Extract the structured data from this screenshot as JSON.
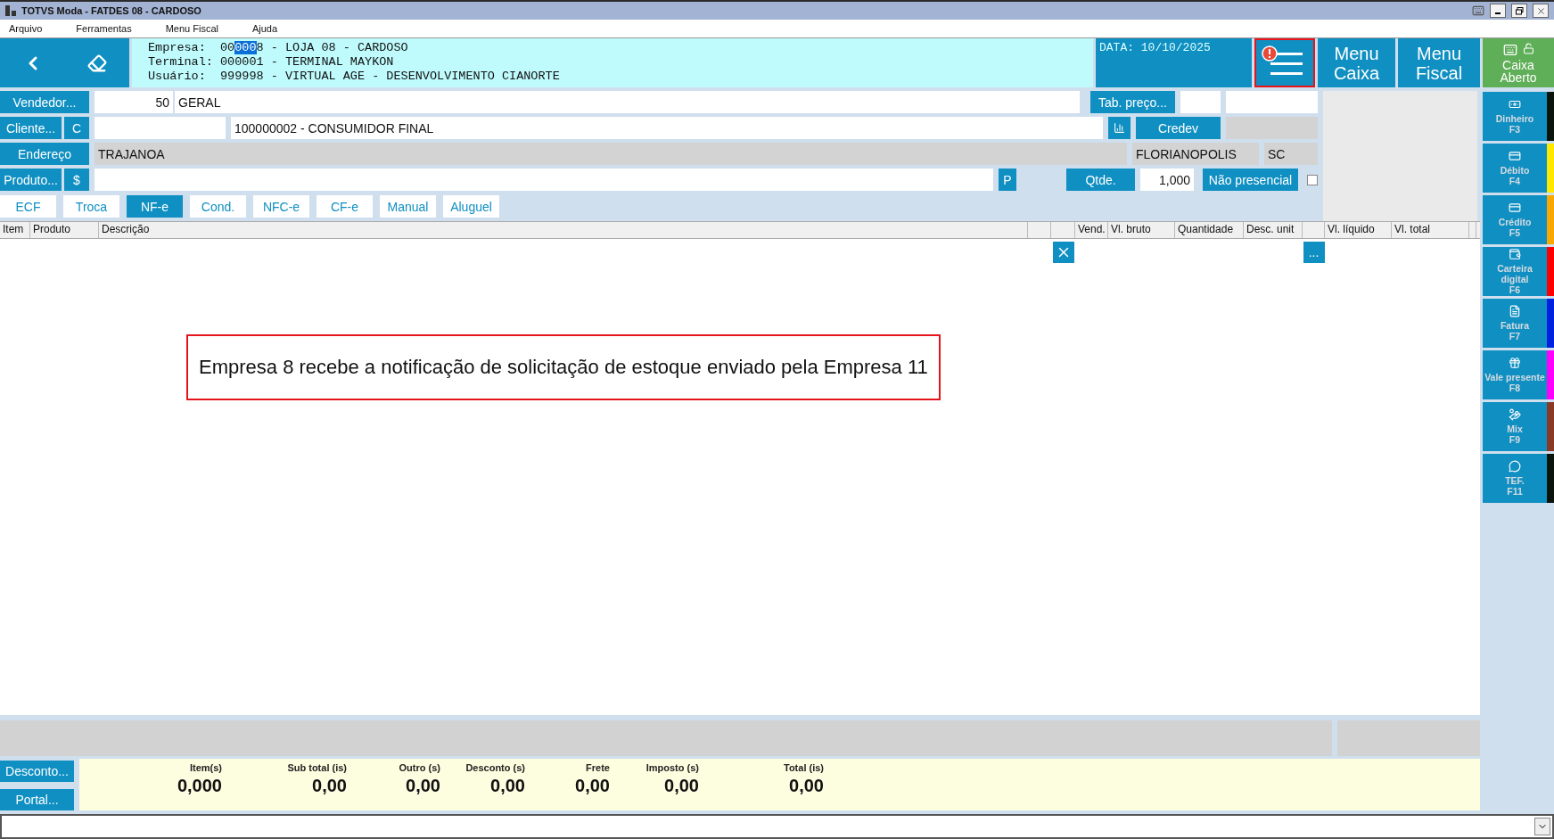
{
  "window": {
    "title": "TOTVS Moda - FATDES 08 - CARDOSO"
  },
  "menu_bar": [
    "Arquivo",
    "Ferramentas",
    "Menu Fiscal",
    "Ajuda"
  ],
  "header": {
    "info_lines": [
      {
        "label": "Empresa:",
        "value_parts": [
          {
            "text": "00",
            "selected": false
          },
          {
            "text": "000",
            "selected": true
          },
          {
            "text": "8 - LOJA 08 - CARDOSO",
            "selected": false
          }
        ]
      },
      {
        "label": "Terminal:",
        "value_parts": [
          {
            "text": "000001 - TERMINAL MAYKON",
            "selected": false
          }
        ]
      },
      {
        "label": "Usuário:",
        "value_parts": [
          {
            "text": "999998 - VIRTUAL AGE - DESENVOLVIMENTO CIANORTE",
            "selected": false
          }
        ]
      }
    ],
    "date": "DATA: 10/10/2025",
    "menu_button": {
      "alert": true,
      "highlighted": true
    },
    "buttons": [
      "Menu Caixa",
      "Menu Fiscal"
    ],
    "cash_status": "Caixa Aberto"
  },
  "form": {
    "vendedor": {
      "button": "Vendedor...",
      "code": "50",
      "name": "GERAL",
      "price_button": "Tab. preço..."
    },
    "cliente": {
      "button": "Cliente...",
      "type_button": "C",
      "name": "100000002 - CONSUMIDOR FINAL",
      "credev_button": "Credev"
    },
    "endereco": {
      "button": "Endereço",
      "street": "TRAJANOA",
      "city": "FLORIANOPOLIS",
      "state": "SC"
    },
    "produto": {
      "button": "Produto...",
      "price_button": "$",
      "search_button": "P",
      "qty_button": "Qtde.",
      "qty": "1,000",
      "remote_button": "Não presencial",
      "remote_checked": false
    }
  },
  "tabs": [
    {
      "label": "ECF",
      "selected": false
    },
    {
      "label": "Troca",
      "selected": false
    },
    {
      "label": "NF-e",
      "selected": true
    },
    {
      "label": "Cond.",
      "selected": false
    },
    {
      "label": "NFC-e",
      "selected": false
    },
    {
      "label": "CF-e",
      "selected": false
    },
    {
      "label": "Manual",
      "selected": false
    },
    {
      "label": "Aluguel",
      "selected": false
    }
  ],
  "table": {
    "columns": [
      {
        "kind": "text",
        "label": "Item"
      },
      {
        "kind": "text",
        "label": "Produto"
      },
      {
        "kind": "text",
        "label": "Descrição"
      },
      {
        "kind": "blank"
      },
      {
        "kind": "remove"
      },
      {
        "kind": "text",
        "label": "Vend."
      },
      {
        "kind": "text",
        "label": "Vl. bruto"
      },
      {
        "kind": "text",
        "label": "Quantidade"
      },
      {
        "kind": "text",
        "label": "Desc. unit"
      },
      {
        "kind": "more",
        "button": "..."
      },
      {
        "kind": "text",
        "label": "Vl. líquido"
      },
      {
        "kind": "text",
        "label": "Vl. total"
      }
    ]
  },
  "annotation": "Empresa 8 recebe a notificação de solicitação de estoque enviado pela Empresa 11",
  "totals": [
    {
      "label": "Item(s)",
      "value": "0,000"
    },
    {
      "label": "Sub total (is)",
      "value": "0,00"
    },
    {
      "label": "Outro (s)",
      "value": "0,00"
    },
    {
      "label": "Desconto (s)",
      "value": "0,00"
    },
    {
      "label": "Frete",
      "value": "0,00"
    },
    {
      "label": "Imposto (s)",
      "value": "0,00"
    },
    {
      "label": "Total (is)",
      "value": "0,00"
    }
  ],
  "footer_buttons": [
    "Desconto...",
    "Portal..."
  ],
  "payments": [
    {
      "kind": "cash",
      "label": "Dinheiro",
      "key": "F3",
      "color": "#0a140a"
    },
    {
      "kind": "debit",
      "label": "Débito",
      "key": "F4",
      "color": "#ffe800"
    },
    {
      "kind": "credit",
      "label": "Crédito",
      "key": "F5",
      "color": "#f8a800"
    },
    {
      "kind": "wallet",
      "label": "Carteira digital",
      "key": "F6",
      "color": "#ff0000"
    },
    {
      "kind": "invoice",
      "label": "Fatura",
      "key": "F7",
      "color": "#0022e0"
    },
    {
      "kind": "gift",
      "label": "Vale presente",
      "key": "F8",
      "color": "#ff00ff"
    },
    {
      "kind": "mix",
      "label": "Mix",
      "key": "F9",
      "color": "#8a3a24"
    },
    {
      "kind": "tef",
      "label": "TEF.",
      "key": "F11",
      "color": "#0a140a"
    }
  ]
}
